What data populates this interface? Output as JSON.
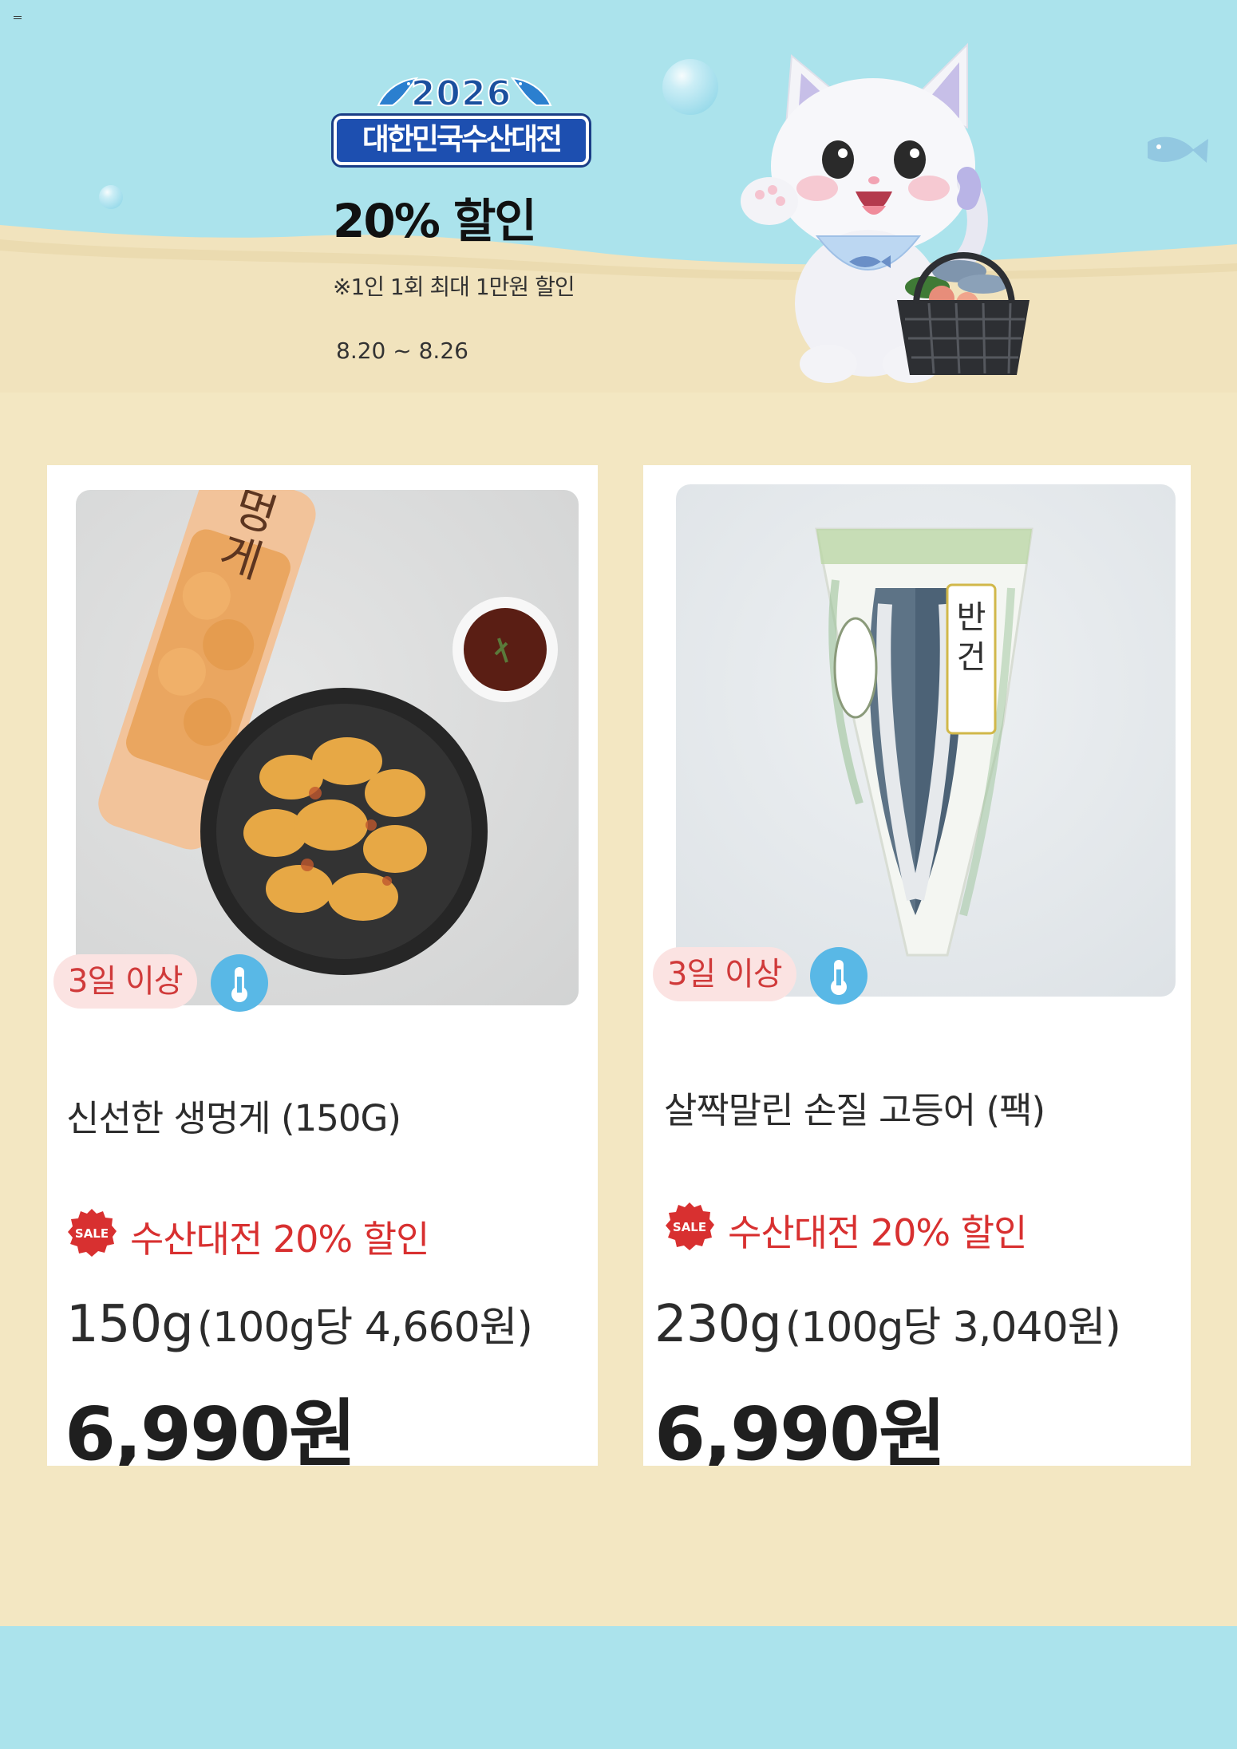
{
  "banner": {
    "menu_icon": "menu-icon",
    "logo_year": "2026",
    "logo_title": "대한민국수산대전",
    "discount_title": "20% 할인",
    "discount_note": "※1인 1회 최대 1만원 할인",
    "period": "8.20 ~ 8.26",
    "mascot": "cat-mascot-with-seafood-basket",
    "colors": {
      "sky": "#abe3ec",
      "sand": "#f3e7c2",
      "logo_blue": "#1d4fb0"
    }
  },
  "products": [
    {
      "image": "fried-sea-squirt-photo",
      "delivery_tag": "3일 이상",
      "storage_icon": "thermometer-icon",
      "name": "신선한 생멍게 (150G)",
      "promo_icon": "sale-icon",
      "promo_badge": "SALE",
      "promo": "수산대전 20% 할인",
      "weight": "150g",
      "unit_price": "(100g당 4,660원)",
      "price": "6,990원"
    },
    {
      "image": "dried-mackerel-pack-photo",
      "delivery_tag": "3일 이상",
      "storage_icon": "thermometer-icon",
      "name": "살짝말린 손질 고등어 (팩)",
      "promo_icon": "sale-icon",
      "promo_badge": "SALE",
      "promo": "수산대전 20% 할인",
      "weight": "230g",
      "unit_price": "(100g당 3,040원)",
      "price": "6,990원"
    }
  ],
  "colors": {
    "promo_red": "#d83030",
    "tag_bg": "#fbe3e2",
    "temp_blue": "#59b8e6",
    "footer": "#abe3ec"
  }
}
